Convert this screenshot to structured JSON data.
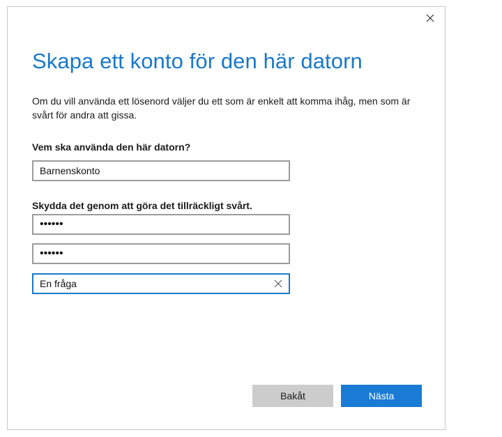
{
  "dialog": {
    "title": "Skapa ett konto för den här datorn",
    "description": "Om du vill använda ett lösenord väljer du ett som är enkelt att komma ihåg, men som är svårt för andra att gissa.",
    "close_icon": "close-icon"
  },
  "form": {
    "who_label": "Vem ska använda den här datorn?",
    "username_value": "Barnenskonto",
    "protect_label": "Skydda det genom att göra det tillräckligt svårt.",
    "password_value": "••••••",
    "password_confirm_value": "••••••",
    "hint_value": "En fråga",
    "clear_icon": "clear-icon"
  },
  "buttons": {
    "back_label": "Bakåt",
    "next_label": "Nästa"
  },
  "colors": {
    "accent": "#1979ca",
    "primary_button": "#1a7bd4",
    "secondary_button": "#cccccc",
    "field_border": "#9b9b9b"
  }
}
